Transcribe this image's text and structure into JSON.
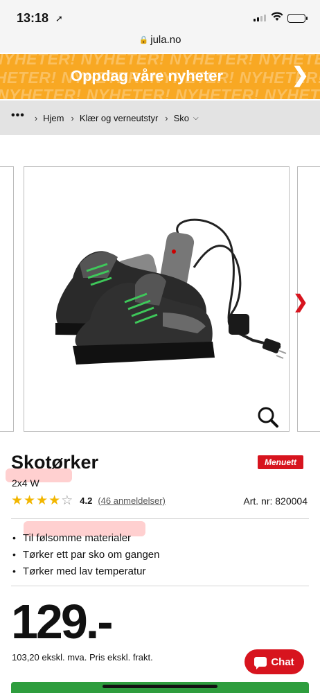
{
  "status_bar": {
    "time": "13:18"
  },
  "url_bar": {
    "domain": "jula.no"
  },
  "promo": {
    "background_text": "NYHETER!",
    "title": "Oppdag våre nyheter",
    "accent_color": "#f8a823"
  },
  "breadcrumb": {
    "more": "•••",
    "items": [
      "Hjem",
      "Klær og verneutstyr",
      "Sko"
    ]
  },
  "product": {
    "title": "Skotørker",
    "brand": "Menuett",
    "variant": "2x4 W",
    "rating": 4.2,
    "rating_text": "4.2",
    "reviews_text": "(46 anmeldelser)",
    "art_nr": "Art. nr: 820004",
    "features": [
      "Til følsomme materialer",
      "Tørker ett par sko om gangen",
      "Tørker med lav temperatur"
    ],
    "price": "129.-",
    "price_note": "103,20 ekskl. mva. Pris ekskl. frakt."
  },
  "chat": {
    "label": "Chat"
  },
  "colors": {
    "brand_red": "#d7141e",
    "star": "#f2b600",
    "cart_green": "#2e9d3e"
  }
}
